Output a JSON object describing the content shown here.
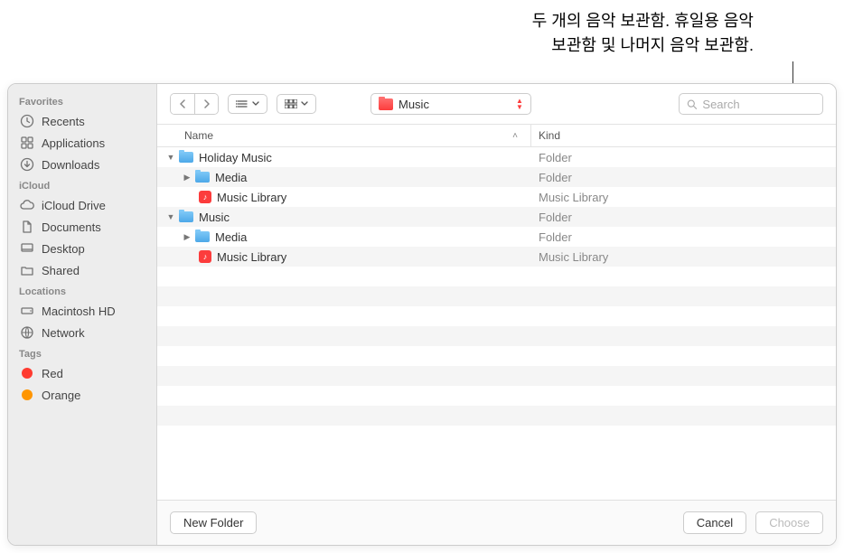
{
  "annotation": {
    "line1": "두 개의 음악 보관함. 휴일용 음악",
    "line2": "보관함 및 나머지 음악 보관함."
  },
  "sidebar": {
    "sections": [
      {
        "header": "Favorites",
        "items": [
          {
            "icon": "clock",
            "label": "Recents"
          },
          {
            "icon": "grid",
            "label": "Applications"
          },
          {
            "icon": "download",
            "label": "Downloads"
          }
        ]
      },
      {
        "header": "iCloud",
        "items": [
          {
            "icon": "cloud",
            "label": "iCloud Drive"
          },
          {
            "icon": "doc",
            "label": "Documents"
          },
          {
            "icon": "desktop",
            "label": "Desktop"
          },
          {
            "icon": "shared",
            "label": "Shared"
          }
        ]
      },
      {
        "header": "Locations",
        "items": [
          {
            "icon": "disk",
            "label": "Macintosh HD"
          },
          {
            "icon": "globe",
            "label": "Network"
          }
        ]
      },
      {
        "header": "Tags",
        "items": [
          {
            "icon": "tag",
            "color": "#ff3b30",
            "label": "Red"
          },
          {
            "icon": "tag",
            "color": "#ff9500",
            "label": "Orange"
          }
        ]
      }
    ]
  },
  "toolbar": {
    "location": "Music",
    "search_placeholder": "Search"
  },
  "columns": {
    "name": "Name",
    "kind": "Kind"
  },
  "rows": [
    {
      "indent": 0,
      "disclosure": "open",
      "icon": "folder",
      "name": "Holiday Music",
      "kind": "Folder"
    },
    {
      "indent": 1,
      "disclosure": "closed",
      "icon": "folder",
      "name": "Media",
      "kind": "Folder"
    },
    {
      "indent": 1,
      "disclosure": "none",
      "icon": "library",
      "name": "Music Library",
      "kind": "Music Library"
    },
    {
      "indent": 0,
      "disclosure": "open",
      "icon": "folder",
      "name": "Music",
      "kind": "Folder"
    },
    {
      "indent": 1,
      "disclosure": "closed",
      "icon": "folder",
      "name": "Media",
      "kind": "Folder"
    },
    {
      "indent": 1,
      "disclosure": "none",
      "icon": "library",
      "name": "Music Library",
      "kind": "Music Library"
    }
  ],
  "footer": {
    "new_folder": "New Folder",
    "cancel": "Cancel",
    "choose": "Choose"
  }
}
